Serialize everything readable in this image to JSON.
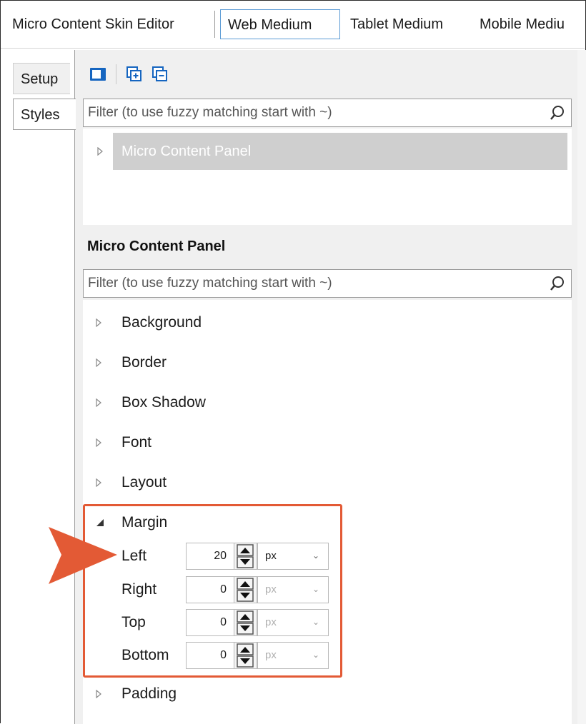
{
  "top_tabs": [
    {
      "label": "Micro Content Skin Editor"
    },
    {
      "label": "Web Medium"
    },
    {
      "label": "Tablet Medium"
    },
    {
      "label": "Mobile Mediu"
    }
  ],
  "left_tabs": [
    {
      "label": "Setup"
    },
    {
      "label": "Styles"
    }
  ],
  "toolbar": {
    "icons": [
      "panel-toggle-icon",
      "expand-all-icon",
      "collapse-all-icon"
    ]
  },
  "style_filter": {
    "placeholder": "Filter (to use fuzzy matching start with ~)"
  },
  "style_tree": {
    "items": [
      {
        "label": "Micro Content Panel"
      }
    ]
  },
  "properties": {
    "title": "Micro Content Panel",
    "filter_placeholder": "Filter (to use fuzzy matching start with ~)",
    "groups": [
      {
        "label": "Background",
        "expanded": false
      },
      {
        "label": "Border",
        "expanded": false
      },
      {
        "label": "Box Shadow",
        "expanded": false
      },
      {
        "label": "Font",
        "expanded": false
      },
      {
        "label": "Layout",
        "expanded": false
      },
      {
        "label": "Margin",
        "expanded": true
      },
      {
        "label": "Padding",
        "expanded": false
      }
    ],
    "margin": [
      {
        "label": "Left",
        "value": "20",
        "unit": "px"
      },
      {
        "label": "Right",
        "value": "0",
        "unit": "px"
      },
      {
        "label": "Top",
        "value": "0",
        "unit": "px"
      },
      {
        "label": "Bottom",
        "value": "0",
        "unit": "px"
      }
    ]
  },
  "colors": {
    "highlight": "#e35a35",
    "active_tab_border": "#5b9bd5",
    "selected_tree_item": "#cfcfcf"
  }
}
